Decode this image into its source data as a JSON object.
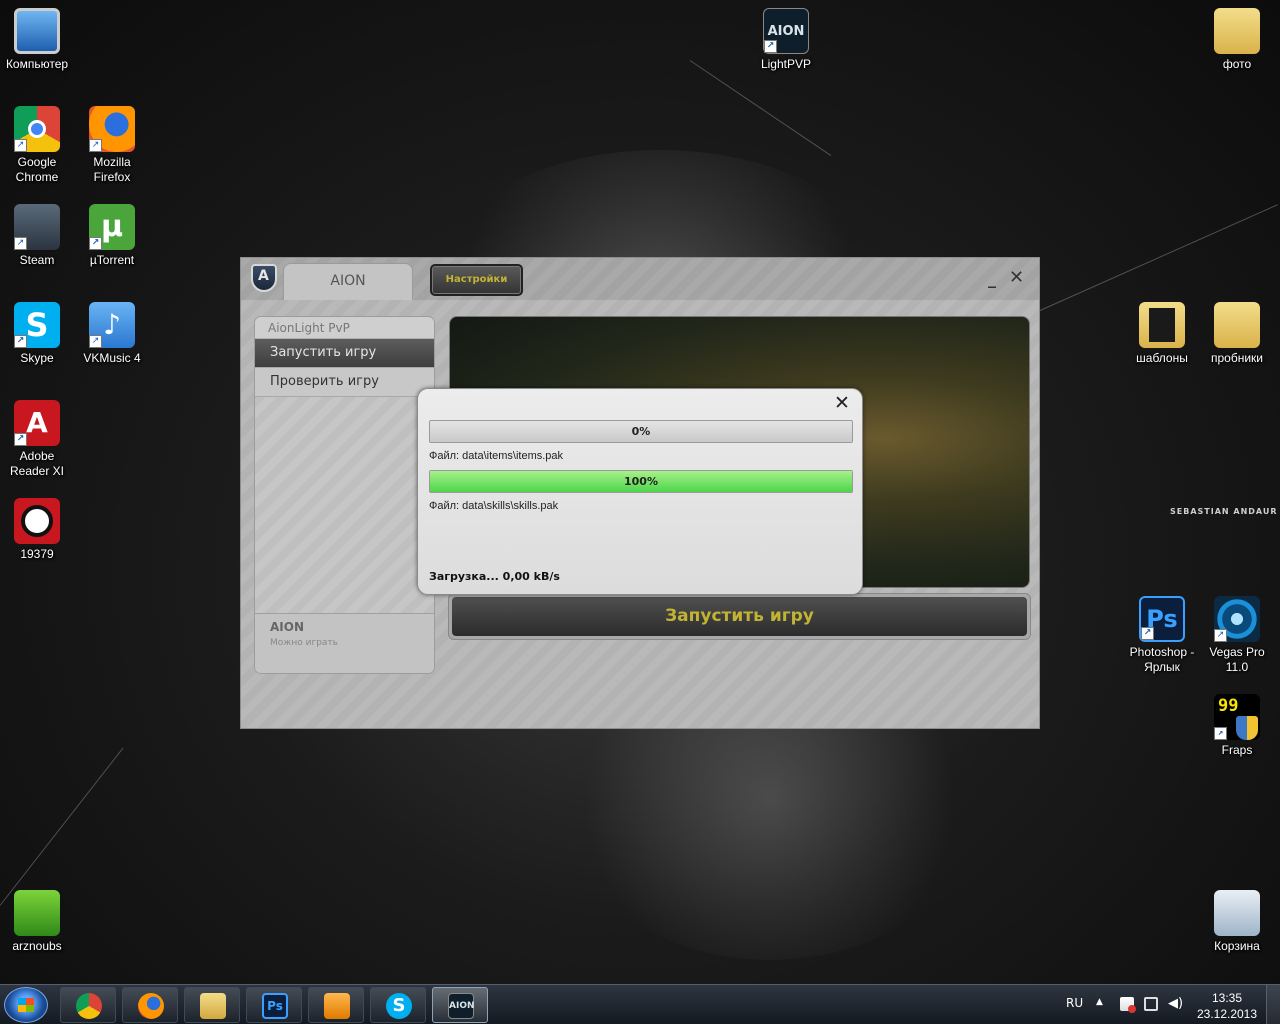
{
  "desktop": {
    "watermark": "SEBASTIAN ANDAUR",
    "icons": {
      "computer": "Компьютер",
      "chrome": "Google\nChrome",
      "firefox": "Mozilla\nFirefox",
      "steam": "Steam",
      "utorrent": "µTorrent",
      "skype": "Skype",
      "vkmusic": "VKMusic 4",
      "adobe": "Adobe\nReader XI",
      "num19379": "19379",
      "arznoubs": "arznoubs",
      "lightpvp": "LightPVP",
      "foto": "фото",
      "shablony": "шаблоны",
      "probniki": "пробники",
      "photoshop": "Photoshop -\nЯрлык",
      "vegas": "Vegas Pro\n11.0",
      "fraps": "Fraps",
      "recycle": "Корзина"
    },
    "icon_glyphs": {
      "aion": "AION",
      "photoshop": "Ps",
      "fraps": "99",
      "skype": "S",
      "utorrent": "µ"
    }
  },
  "launcher": {
    "tab_label": "AION",
    "settings_label": "Настройки",
    "minimize_label": "_",
    "close_label": "✕",
    "sidebar": {
      "header": "AionLight PvP",
      "items": [
        {
          "label": "Запустить игру"
        },
        {
          "label": "Проверить игру"
        }
      ],
      "footer_title": "AION",
      "footer_status": "Можно играть"
    },
    "launch_label": "Запустить игру"
  },
  "dialog": {
    "close_label": "✕",
    "progress": [
      {
        "percent_label": "0%",
        "fraction": 0.0,
        "file": "Файл: data\\items\\items.pak"
      },
      {
        "percent_label": "100%",
        "fraction": 1.0,
        "file": "Файл: data\\skills\\skills.pak"
      }
    ],
    "speed": "Загрузка... 0,00 kB/s"
  },
  "taskbar": {
    "items": [
      "chrome",
      "firefox",
      "explorer",
      "photoshop",
      "media-player",
      "skype",
      "aion"
    ],
    "active_item": "aion",
    "aion_glyph": "AION",
    "ps_glyph": "Ps",
    "skype_glyph": "S",
    "lang": "RU",
    "time": "13:35",
    "date": "23.12.2013"
  }
}
